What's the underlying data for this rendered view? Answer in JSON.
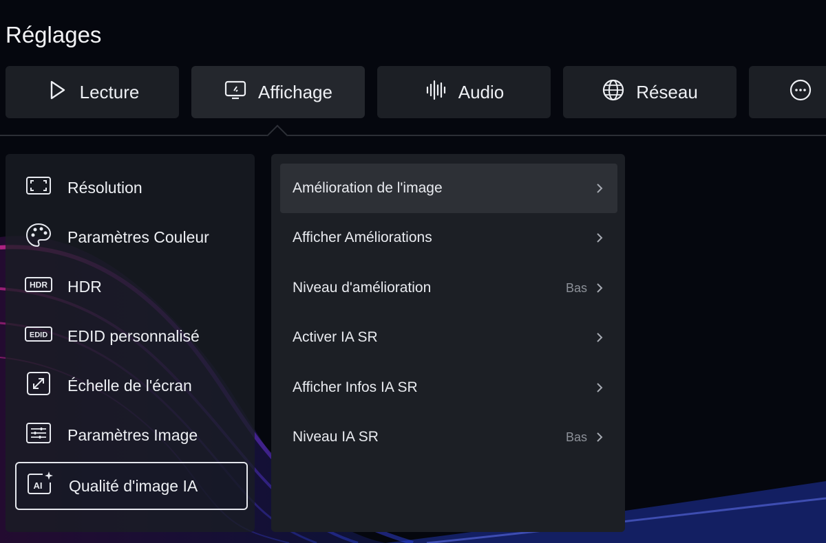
{
  "app": {
    "title": "Réglages"
  },
  "tabs": [
    {
      "label": "Lecture",
      "icon": "play-icon",
      "active": false
    },
    {
      "label": "Affichage",
      "icon": "display-icon",
      "active": true
    },
    {
      "label": "Audio",
      "icon": "audio-wave-icon",
      "active": false
    },
    {
      "label": "Réseau",
      "icon": "globe-icon",
      "active": false
    },
    {
      "label": "",
      "icon": "more-icon",
      "active": false
    }
  ],
  "sidebar": {
    "items": [
      {
        "label": "Résolution",
        "icon": "resolution-frame-icon"
      },
      {
        "label": "Paramètres Couleur",
        "icon": "palette-icon"
      },
      {
        "label": "HDR",
        "icon": "hdr-icon",
        "badge": "HDR"
      },
      {
        "label": "EDID personnalisé",
        "icon": "edid-icon",
        "badge": "EDID"
      },
      {
        "label": "Échelle de l'écran",
        "icon": "screen-scale-icon"
      },
      {
        "label": "Paramètres Image",
        "icon": "image-settings-icon"
      },
      {
        "label": "Qualité d'image IA",
        "icon": "ai-sparkle-icon",
        "badge": "AI",
        "selected": true
      }
    ]
  },
  "submenu": {
    "items": [
      {
        "label": "Amélioration de l'image",
        "value": "",
        "highlighted": true
      },
      {
        "label": "Afficher Améliorations",
        "value": ""
      },
      {
        "label": "Niveau d'amélioration",
        "value": "Bas"
      },
      {
        "label": "Activer IA SR",
        "value": ""
      },
      {
        "label": "Afficher Infos IA SR",
        "value": ""
      },
      {
        "label": "Niveau IA SR",
        "value": "Bas"
      }
    ]
  },
  "colors": {
    "background": "#05070e",
    "panel": "#1c1f25",
    "highlight": "#2d3036",
    "accent_wave_magenta": "#c02ad8",
    "accent_wave_blue": "#3a5bff"
  }
}
